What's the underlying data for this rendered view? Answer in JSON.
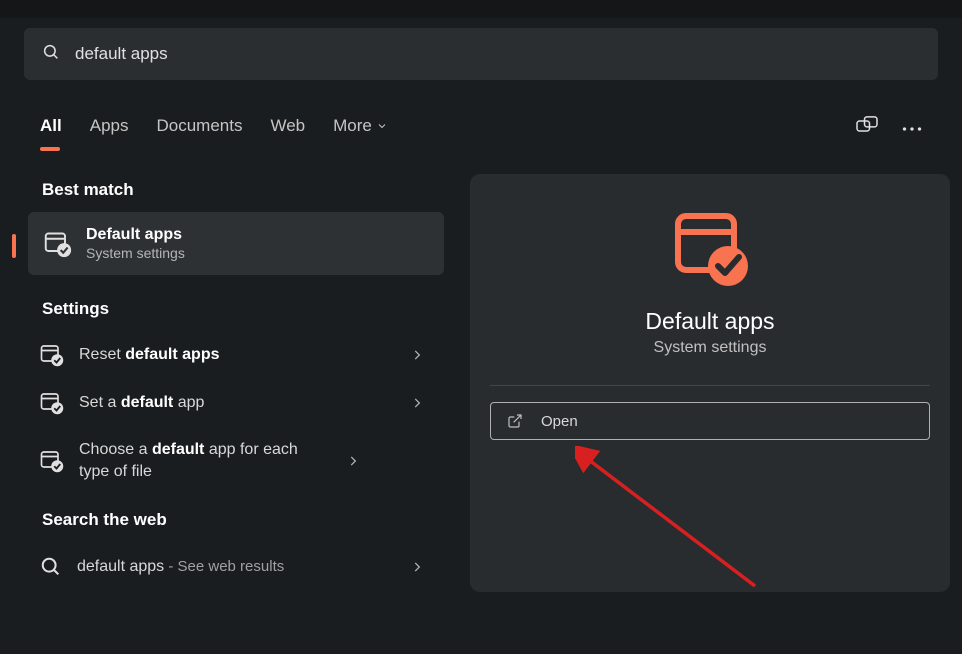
{
  "search": {
    "query": "default apps"
  },
  "tabs": {
    "all": "All",
    "apps": "Apps",
    "documents": "Documents",
    "web": "Web",
    "more": "More"
  },
  "sections": {
    "best_match": "Best match",
    "settings": "Settings",
    "search_web": "Search the web"
  },
  "best_match": {
    "title": "Default apps",
    "subtitle": "System settings"
  },
  "settings_items": [
    {
      "prefix": "Reset ",
      "bold": "default apps",
      "suffix": ""
    },
    {
      "prefix": "Set a ",
      "bold": "default",
      "suffix": " app"
    },
    {
      "prefix": "Choose a ",
      "bold": "default",
      "suffix": " app for each type of file"
    }
  ],
  "web_item": {
    "text": "default apps",
    "sub": " - See web results"
  },
  "detail": {
    "title": "Default apps",
    "subtitle": "System settings",
    "open": "Open"
  }
}
